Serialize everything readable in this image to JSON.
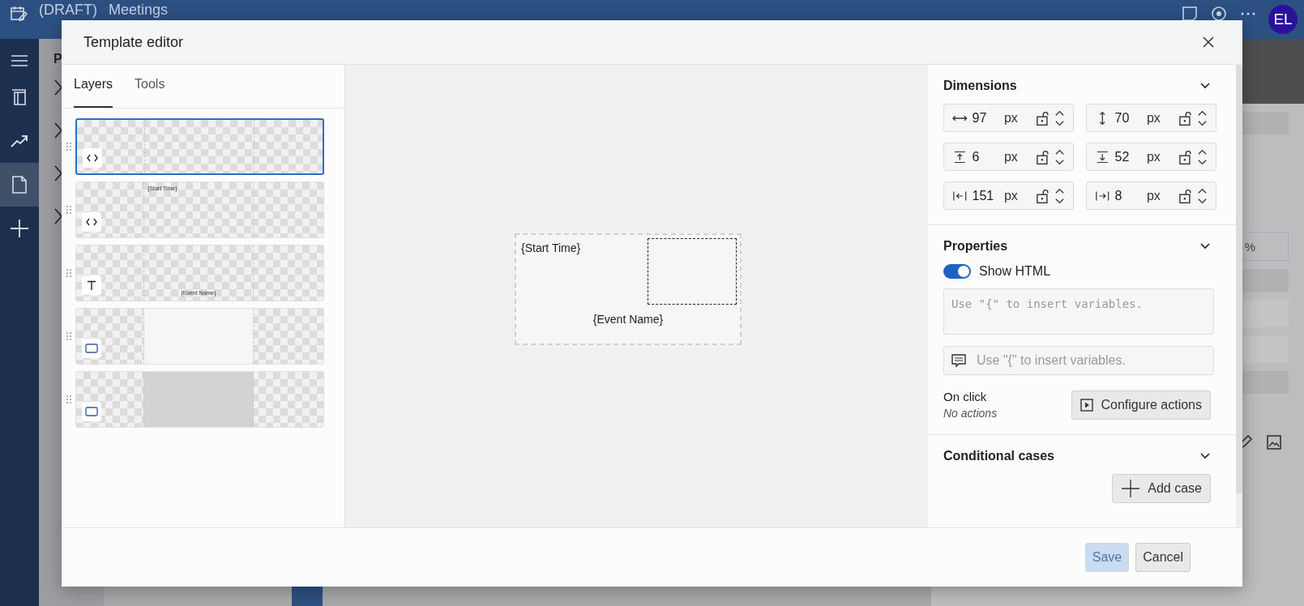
{
  "app_bar": {
    "title_prefix": "(DRAFT)",
    "title": "Meetings",
    "avatar": "EL"
  },
  "nav_items": [
    {
      "kind": "pages",
      "selected": false
    },
    {
      "kind": "trend",
      "selected": false
    },
    {
      "kind": "document",
      "selected": true
    },
    {
      "kind": "add",
      "selected": false
    }
  ],
  "background": {
    "panel_letter": "P",
    "unit": "%"
  },
  "dialog": {
    "title": "Template editor",
    "tabs": [
      {
        "label": "Layers",
        "selected": true
      },
      {
        "label": "Tools",
        "selected": false
      }
    ],
    "layers": [
      {
        "kind": "html",
        "selected": true
      },
      {
        "kind": "html",
        "selected": false,
        "text": "{Start Time}",
        "text_at_bottom": false
      },
      {
        "kind": "text",
        "selected": false,
        "text": "{Event Name}",
        "text_at_bottom": true
      },
      {
        "kind": "rect",
        "selected": false,
        "color": "#f5f6f5"
      },
      {
        "kind": "rect",
        "selected": false,
        "color": "#d3d3d5"
      }
    ],
    "canvas": {
      "start_text": "{Start Time}",
      "center_text": "{Event Name}"
    },
    "dimensions": {
      "title": "Dimensions",
      "expanded": true,
      "fields": [
        {
          "kind": "width",
          "value": "97",
          "unit": "px"
        },
        {
          "kind": "height",
          "value": "70",
          "unit": "px"
        },
        {
          "kind": "top",
          "value": "6",
          "unit": "px"
        },
        {
          "kind": "bottom",
          "value": "52",
          "unit": "px"
        },
        {
          "kind": "left",
          "value": "151",
          "unit": "px"
        },
        {
          "kind": "right",
          "value": "8",
          "unit": "px"
        }
      ]
    },
    "properties": {
      "title": "Properties",
      "expanded": true,
      "show_html": {
        "label": "Show HTML",
        "on": true
      },
      "html_placeholder": "Use \"{\" to insert variables.",
      "tooltip_placeholder": "Use \"{\" to insert variables.",
      "on_click_label": "On click",
      "on_click_value": "No actions",
      "configure_button": "Configure actions"
    },
    "conditional": {
      "title": "Conditional cases",
      "expanded": true,
      "add_button": "Add case"
    },
    "buttons": [
      {
        "label": "Save",
        "disabled": true
      },
      {
        "label": "Cancel",
        "disabled": false
      }
    ]
  }
}
